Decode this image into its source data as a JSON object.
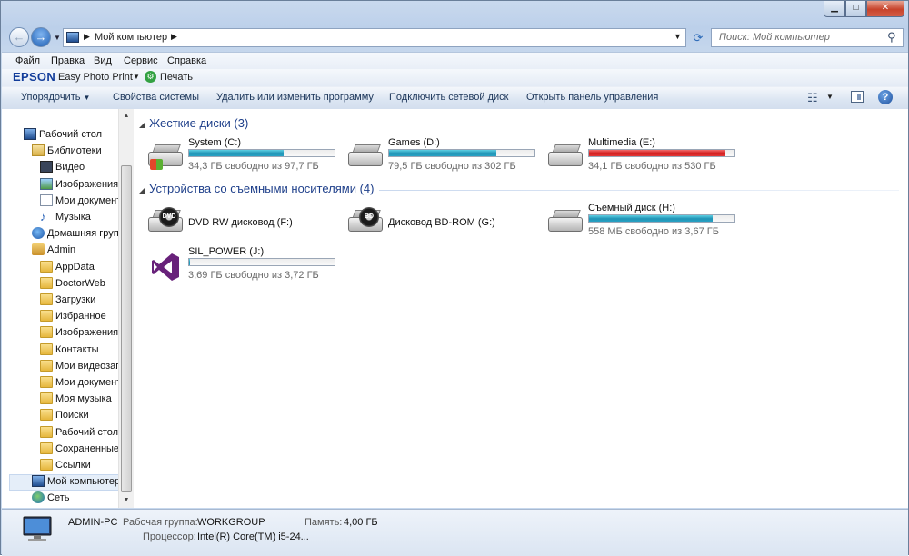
{
  "window": {
    "controls": {
      "minimize": "▁",
      "maximize": "□",
      "close": "✕"
    }
  },
  "nav": {
    "back_icon": "back-arrow-icon",
    "forward_icon": "forward-arrow-icon",
    "address": {
      "location": "Мой компьютер"
    },
    "search": {
      "placeholder": "Поиск: Мой компьютер"
    }
  },
  "menu": {
    "items": [
      "Файл",
      "Правка",
      "Вид",
      "Сервис",
      "Справка"
    ]
  },
  "epson": {
    "logo": "EPSON",
    "app": "Easy Photo Print",
    "print_label": "Печать"
  },
  "commandbar": {
    "items": [
      "Упорядочить",
      "Свойства системы",
      "Удалить или изменить программу",
      "Подключить сетевой диск",
      "Открыть панель управления"
    ]
  },
  "sidebar": {
    "items": [
      {
        "label": "Рабочий стол",
        "icon": "desktop-icon"
      },
      {
        "label": "Библиотеки",
        "icon": "libraries-icon"
      },
      {
        "label": "Видео",
        "icon": "video-library-icon"
      },
      {
        "label": "Изображения",
        "icon": "pictures-library-icon"
      },
      {
        "label": "Мои документ",
        "icon": "documents-library-icon"
      },
      {
        "label": "Музыка",
        "icon": "music-library-icon"
      },
      {
        "label": "Домашняя груп",
        "icon": "homegroup-icon"
      },
      {
        "label": "Admin",
        "icon": "user-folder-icon"
      },
      {
        "label": "AppData",
        "icon": "folder-icon"
      },
      {
        "label": "DoctorWeb",
        "icon": "folder-icon"
      },
      {
        "label": "Загрузки",
        "icon": "downloads-folder-icon"
      },
      {
        "label": "Избранное",
        "icon": "favorites-folder-icon"
      },
      {
        "label": "Изображения",
        "icon": "pictures-folder-icon"
      },
      {
        "label": "Контакты",
        "icon": "contacts-folder-icon"
      },
      {
        "label": "Мои видеозап",
        "icon": "videos-folder-icon"
      },
      {
        "label": "Мои документ",
        "icon": "documents-folder-icon"
      },
      {
        "label": "Моя музыка",
        "icon": "music-folder-icon"
      },
      {
        "label": "Поиски",
        "icon": "searches-folder-icon"
      },
      {
        "label": "Рабочий стол",
        "icon": "desktop-folder-icon"
      },
      {
        "label": "Сохраненные",
        "icon": "saved-games-folder-icon"
      },
      {
        "label": "Ссылки",
        "icon": "links-folder-icon"
      },
      {
        "label": "Мой компьютер",
        "icon": "computer-icon",
        "selected": true
      },
      {
        "label": "Сеть",
        "icon": "network-icon"
      }
    ]
  },
  "content": {
    "groups": [
      {
        "title": "Жесткие диски (3)",
        "drives": [
          {
            "name": "System (C:)",
            "free": "34,3 ГБ свободно из 97,7 ГБ",
            "used_fraction": 0.649,
            "bar_color": "#1f93b5",
            "icon": "hard-drive-windows-icon"
          },
          {
            "name": "Games (D:)",
            "free": "79,5 ГБ свободно из 302 ГБ",
            "used_fraction": 0.737,
            "bar_color": "#1f93b5",
            "icon": "hard-drive-icon"
          },
          {
            "name": "Multimedia (E:)",
            "free": "34,1 ГБ свободно из 530 ГБ",
            "used_fraction": 0.936,
            "bar_color": "#d11d1d",
            "icon": "hard-drive-icon"
          }
        ]
      },
      {
        "title": "Устройства со съемными носителями (4)",
        "drives": [
          {
            "name": "DVD RW дисковод (F:)",
            "free": "",
            "used_fraction": null,
            "icon": "dvd-drive-icon",
            "badge": "DVD"
          },
          {
            "name": "Дисковод BD-ROM (G:)",
            "free": "",
            "used_fraction": null,
            "icon": "bd-drive-icon",
            "badge": "BD"
          },
          {
            "name": "Съемный диск (H:)",
            "free": "558 МБ свободно из 3,67 ГБ",
            "used_fraction": 0.852,
            "bar_color": "#1f93b5",
            "icon": "removable-drive-icon"
          },
          {
            "name": "SIL_POWER (J:)",
            "free": "3,69 ГБ свободно из 3,72 ГБ",
            "used_fraction": 0.008,
            "bar_color": "#1f93b5",
            "icon": "visual-studio-icon"
          }
        ]
      }
    ]
  },
  "details": {
    "pc_name": "ADMIN-PC",
    "workgroup_label": "Рабочая группа:",
    "workgroup": "WORKGROUP",
    "memory_label": "Память:",
    "memory": "4,00 ГБ",
    "cpu_label": "Процессор:",
    "cpu": "Intel(R) Core(TM) i5-24..."
  }
}
